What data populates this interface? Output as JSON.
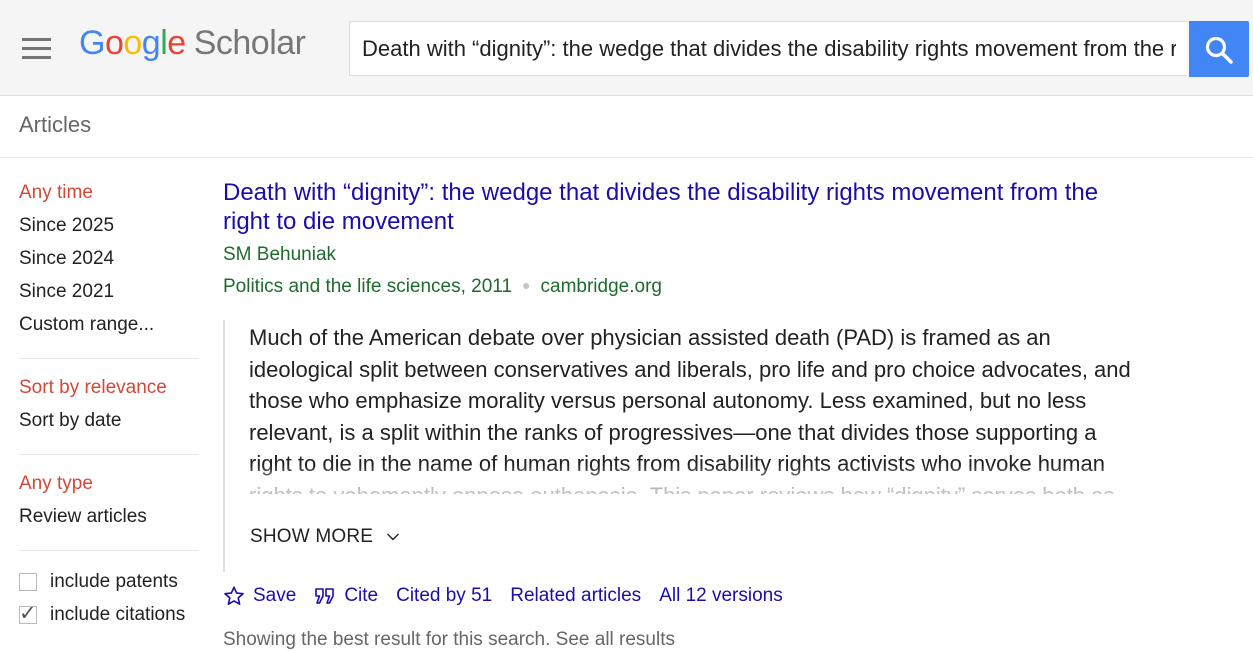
{
  "header": {
    "logo_letters": [
      "G",
      "o",
      "o",
      "g",
      "l",
      "e"
    ],
    "logo_product": "Scholar",
    "search_value": "Death with “dignity”: the wedge that divides the disability rights movement from the right to die movement",
    "search_icon": "search-icon",
    "menu_icon": "hamburger-menu-icon",
    "accent_color": "#4285f4"
  },
  "subheader": {
    "label": "Articles"
  },
  "sidebar": {
    "time_filters": [
      "Any time",
      "Since 2025",
      "Since 2024",
      "Since 2021",
      "Custom range..."
    ],
    "sort_options": [
      "Sort by relevance",
      "Sort by date"
    ],
    "type_filters": [
      "Any type",
      "Review articles"
    ],
    "checkboxes": [
      {
        "label": "include patents",
        "checked": false
      },
      {
        "label": "include citations",
        "checked": true
      }
    ],
    "active_color": "#d14836"
  },
  "result": {
    "title": "Death with “dignity”: the wedge that divides the disability rights movement from the right to die movement",
    "authors": "SM Behuniak",
    "venue": "Politics and the life sciences, 2011",
    "source": "cambridge.org",
    "abstract": "Much of the American debate over physician assisted death (PAD) is framed as an ideological split between conservatives and liberals, pro life and pro choice advocates, and those who emphasize morality versus personal autonomy. Less examined, but no less relevant, is a split within the ranks of progressives—one that divides those supporting a right to die in the name of human rights from disability rights activists who invoke human rights to vehemently oppose euthanasia. This paper reviews how “dignity” serves both as",
    "show_more": "SHOW MORE",
    "actions": {
      "save": "Save",
      "cite": "Cite",
      "cited_by": "Cited by 51",
      "related": "Related articles",
      "versions": "All 12 versions"
    },
    "link_color": "#1a0dab",
    "meta_color": "#1e6b2d"
  },
  "footer_line": "Showing the best result for this search. See all results"
}
